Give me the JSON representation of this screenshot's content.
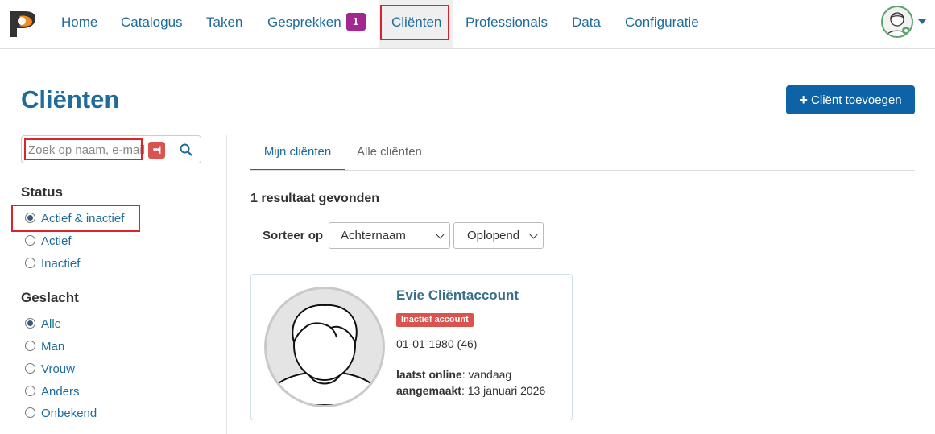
{
  "nav": {
    "items": [
      {
        "label": "Home"
      },
      {
        "label": "Catalogus"
      },
      {
        "label": "Taken"
      },
      {
        "label": "Gesprekken",
        "badge": "1"
      },
      {
        "label": "Cliënten"
      },
      {
        "label": "Professionals"
      },
      {
        "label": "Data"
      },
      {
        "label": "Configuratie"
      }
    ],
    "active": "Cliënten"
  },
  "page": {
    "title": "Cliënten",
    "add_button": "Cliënt toevoegen"
  },
  "search": {
    "placeholder": "Zoek op naam, e-mail"
  },
  "filters": {
    "status": {
      "title": "Status",
      "options": [
        "Actief & inactief",
        "Actief",
        "Inactief"
      ],
      "selected": "Actief & inactief"
    },
    "gender": {
      "title": "Geslacht",
      "options": [
        "Alle",
        "Man",
        "Vrouw",
        "Anders",
        "Onbekend"
      ],
      "selected": "Alle"
    }
  },
  "tabs": [
    {
      "label": "Mijn cliënten",
      "active": true
    },
    {
      "label": "Alle cliënten",
      "active": false
    }
  ],
  "results": {
    "count_text": "1 resultaat gevonden",
    "sort_label": "Sorteer op",
    "sort_field": "Achternaam",
    "sort_order": "Oplopend"
  },
  "client": {
    "name": "Evie Cliëntaccount",
    "badge": "Inactief account",
    "birthdate": "01-01-1980 (46)",
    "last_online_label": "laatst online",
    "last_online_value": ": vandaag",
    "created_label": "aangemaakt",
    "created_value": ": 13 januari 2026"
  },
  "colors": {
    "primary": "#1f6c9b",
    "button": "#0d63a5",
    "badge_purple": "#a3278f",
    "badge_red": "#d9534f",
    "highlight": "#d9232d"
  }
}
